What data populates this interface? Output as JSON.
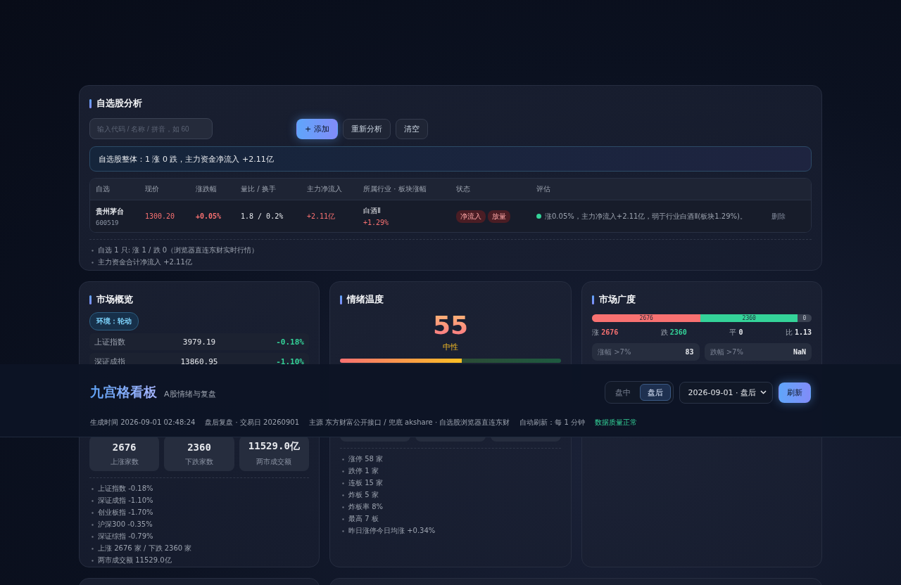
{
  "watchlist": {
    "title": "自选股分析",
    "search": {
      "placeholder": "输入代码 / 名称 / 拼音，如 60"
    },
    "buttons": [
      {
        "label": "+ 添加",
        "kind": "primary"
      },
      {
        "label": "重新分析",
        "kind": "plain"
      },
      {
        "label": "清空",
        "kind": "plain"
      }
    ],
    "summary": "自选股整体：1 涨 0 跌，主力资金净流入 +2.11亿",
    "table": {
      "columns": [
        "自选",
        "现价",
        "涨跌幅",
        "量比 / 换手",
        "主力净流入",
        "所属行业 · 板块涨幅",
        "状态",
        "评估"
      ],
      "rows": [
        {
          "name": "贵州茅台",
          "code": "600519",
          "price": "1300.20",
          "change": "+0.05%",
          "ratio": "1.8 / 0.2%",
          "inflow": "+2.11亿",
          "industry": "白酒Ⅱ",
          "industry_change": "+1.29%",
          "tags": [
            "净流入",
            "放量"
          ],
          "color": "#34d399",
          "assessment": "涨0.05%，主力净流入+2.11亿，弱于行业白酒Ⅱ(板块1.29%)。",
          "action": "删除"
        }
      ]
    },
    "notes": [
      "自选 1 只: 涨 1 / 跌 0（浏览器直连东财实时行情）",
      "主力资金合计净流入 +2.11亿"
    ]
  },
  "overview": {
    "title": "市场概览",
    "env": "环境：轮动",
    "indices": [
      {
        "name": "上证指数",
        "value": "3979.19",
        "change": "-0.18%",
        "color": "#34d399"
      },
      {
        "name": "深证成指",
        "value": "13860.95",
        "change": "-1.10%",
        "color": "#34d399"
      }
    ],
    "stats": [
      {
        "value": "2676",
        "label": "上涨家数"
      },
      {
        "value": "2360",
        "label": "下跌家数"
      },
      {
        "value": "11529.0亿",
        "label": "两市成交额"
      }
    ],
    "notes": [
      "上证指数 -0.18%",
      "深证成指 -1.10%",
      "创业板指 -1.70%",
      "沪深300 -0.35%",
      "深证综指 -0.79%",
      "上涨 2676 家 / 下跌 2360 家",
      "两市成交额 11529.0亿"
    ]
  },
  "sentiment": {
    "title": "情绪温度",
    "score": "55",
    "label": "中性",
    "level": 0.55,
    "notes": [
      "涨停 58 家",
      "跌停 1 家",
      "连板 15 家",
      "炸板 5 家",
      "炸板率 8%",
      "最高 7 板",
      "昨日涨停今日均涨 +0.34%"
    ]
  },
  "breadth": {
    "title": "市场广度",
    "segments": [
      {
        "value": "2676",
        "level": 0.495,
        "color": "#f87171"
      },
      {
        "value": "2360",
        "color": "#34d399"
      },
      {
        "value": "0",
        "color": "#3b4252"
      }
    ],
    "stats": [
      {
        "label": "涨",
        "value": "2676",
        "color": "#f87171"
      },
      {
        "label": "跌",
        "value": "2360",
        "color": "#34d399"
      },
      {
        "label": "平",
        "value": "0",
        "color": "#e5e7eb"
      },
      {
        "label": "比",
        "value": "1.13",
        "color": "#e5e7eb"
      }
    ],
    "tiles": [
      {
        "label": "涨幅 >7%",
        "value": "83"
      },
      {
        "label": "跌幅 >7%",
        "value": "NaN"
      }
    ]
  },
  "header": {
    "title": "九宫格看板",
    "subtitle": "A股情绪与复盘",
    "modes": [
      {
        "label": "盘中",
        "selected": false
      },
      {
        "label": "盘后",
        "selected": true
      }
    ],
    "date_select": "2026-09-01 · 盘后",
    "refresh": "刷新",
    "meta": [
      {
        "text": "生成时间 2026-09-01 02:48:24",
        "kind": "plain"
      },
      {
        "text": "盘后复盘 · 交易日 20260901",
        "kind": "plain"
      },
      {
        "text": "主源 东方财富公开接口 / 兜底 akshare · 自选股浏览器直连东财",
        "kind": "plain"
      },
      {
        "text": "自动刷新：每 1 分钟",
        "kind": "plain"
      },
      {
        "text": "数据质量正常",
        "kind": "ok"
      }
    ]
  }
}
